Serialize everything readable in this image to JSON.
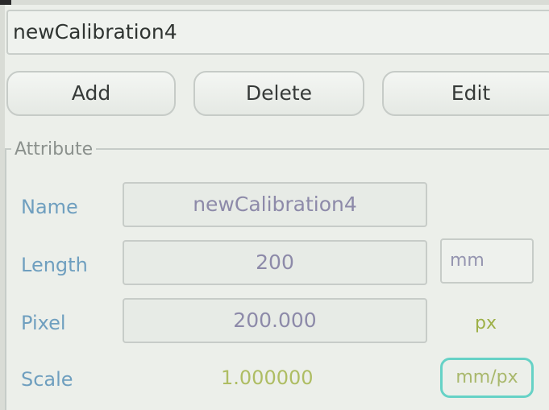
{
  "calibration_name_header": "newCalibration4",
  "buttons": {
    "add": "Add",
    "delete": "Delete",
    "edit": "Edit"
  },
  "attribute": {
    "group_title": "Attribute",
    "name": {
      "label": "Name",
      "value": "newCalibration4"
    },
    "length": {
      "label": "Length",
      "value": "200",
      "unit": "mm"
    },
    "pixel": {
      "label": "Pixel",
      "value": "200.000",
      "unit": "px"
    },
    "scale": {
      "label": "Scale",
      "value": "1.000000",
      "unit": "mm/px"
    }
  },
  "colors": {
    "label_blue": "#6f9fbf",
    "unit_green": "#9db046",
    "highlight_teal": "#66d2c6"
  }
}
